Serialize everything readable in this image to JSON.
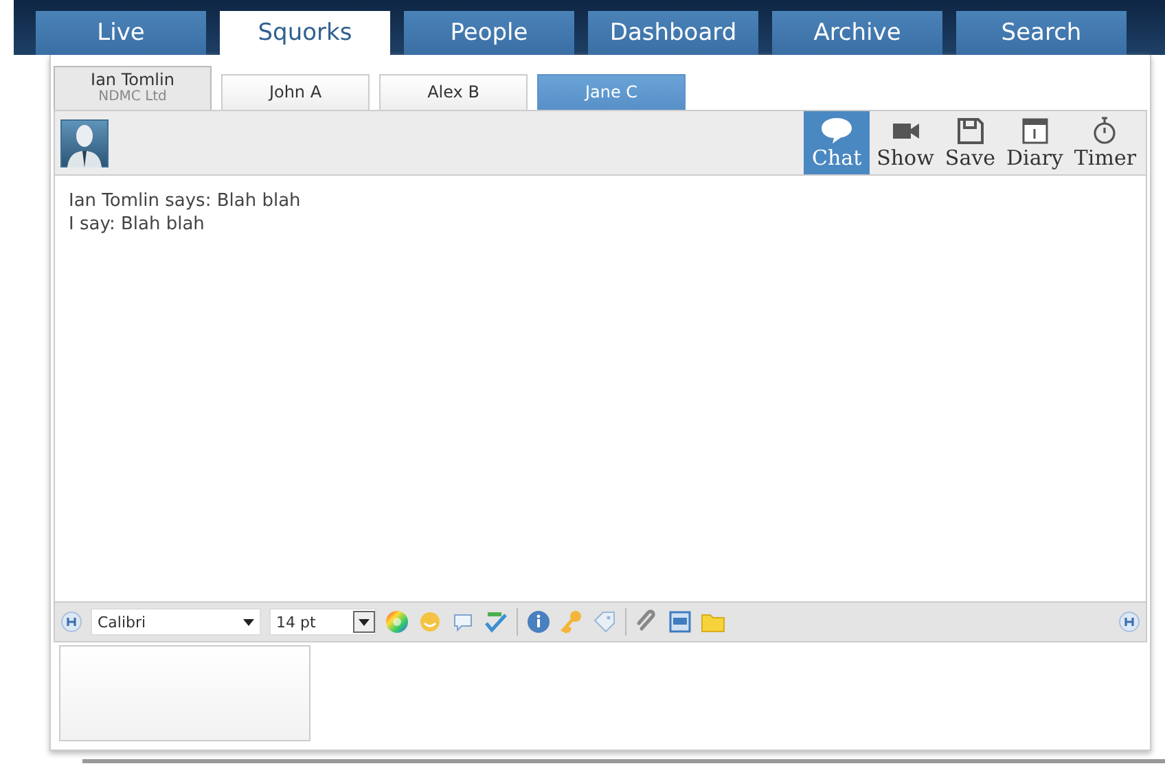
{
  "nav_tabs": [
    {
      "label": "Live",
      "selected": false
    },
    {
      "label": "Squorks",
      "selected": true
    },
    {
      "label": "People",
      "selected": false
    },
    {
      "label": "Dashboard",
      "selected": false
    },
    {
      "label": "Archive",
      "selected": false
    },
    {
      "label": "Search",
      "selected": false
    }
  ],
  "contact_tabs": [
    {
      "name": "Ian Tomlin",
      "subtitle": "NDMC Ltd",
      "selected": true,
      "highlighted": false
    },
    {
      "name": "John A",
      "selected": false,
      "highlighted": false
    },
    {
      "name": "Alex B",
      "selected": false,
      "highlighted": false
    },
    {
      "name": "Jane C",
      "selected": false,
      "highlighted": true
    }
  ],
  "toolbar": [
    {
      "label": "Chat",
      "kind": "chat",
      "selected": true
    },
    {
      "label": "Show",
      "kind": "video",
      "selected": false
    },
    {
      "label": "Save",
      "kind": "save",
      "selected": false
    },
    {
      "label": "Diary",
      "kind": "calendar",
      "selected": false
    },
    {
      "label": "Timer",
      "kind": "timer",
      "selected": false
    }
  ],
  "messages": [
    "Ian Tomlin says: Blah blah",
    "I say: Blah blah"
  ],
  "format_bar": {
    "font": "Calibri",
    "size": "14 pt"
  }
}
